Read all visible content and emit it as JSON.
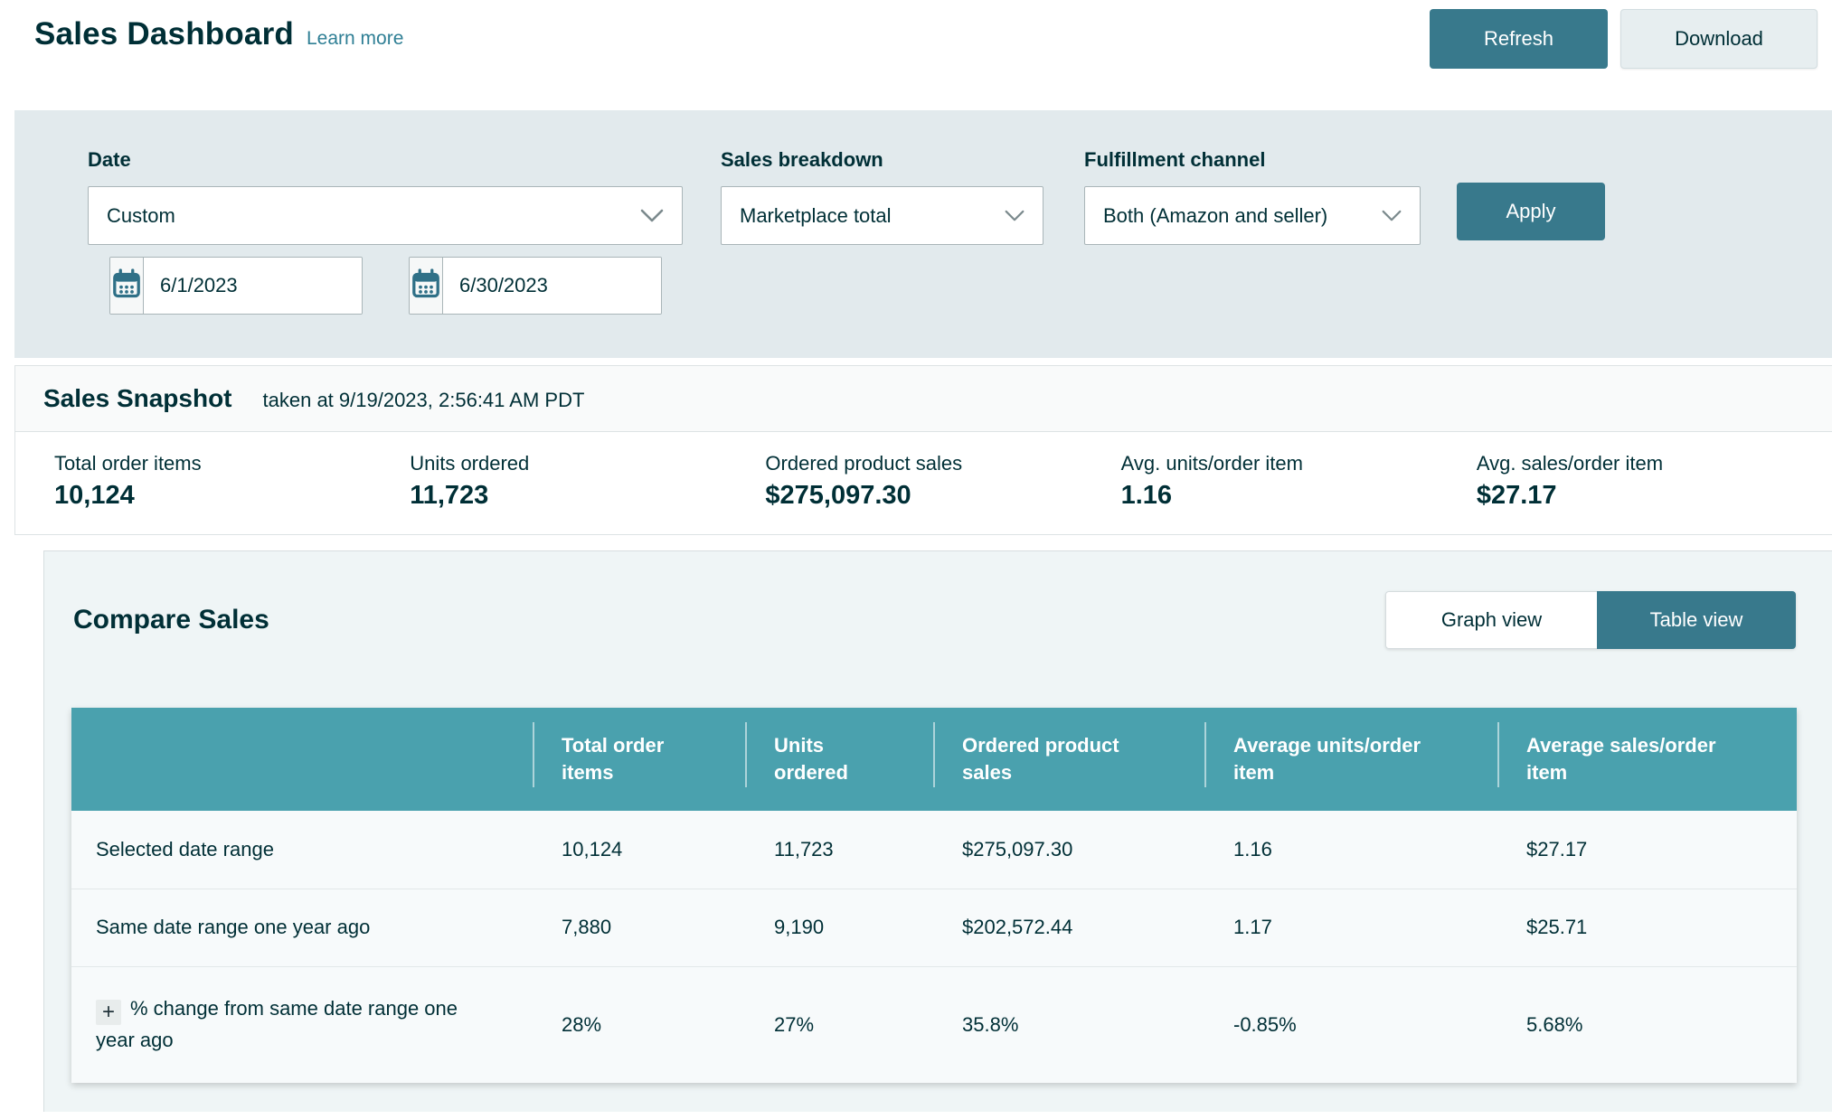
{
  "page": {
    "title": "Sales Dashboard",
    "learn_more": "Learn more"
  },
  "header_actions": {
    "refresh": "Refresh",
    "download": "Download"
  },
  "filters": {
    "date": {
      "label": "Date",
      "value": "Custom",
      "start_date": "6/1/2023",
      "end_date": "6/30/2023"
    },
    "sales_breakdown": {
      "label": "Sales breakdown",
      "value": "Marketplace total"
    },
    "fulfillment_channel": {
      "label": "Fulfillment channel",
      "value": "Both (Amazon and seller)"
    },
    "apply": "Apply"
  },
  "snapshot": {
    "title": "Sales Snapshot",
    "taken_at": "taken at 9/19/2023, 2:56:41 AM PDT",
    "stats": [
      {
        "label": "Total order items",
        "value": "10,124"
      },
      {
        "label": "Units ordered",
        "value": "11,723"
      },
      {
        "label": "Ordered product sales",
        "value": "$275,097.30"
      },
      {
        "label": "Avg. units/order item",
        "value": "1.16"
      },
      {
        "label": "Avg. sales/order item",
        "value": "$27.17"
      }
    ]
  },
  "compare": {
    "title": "Compare Sales",
    "views": {
      "graph": "Graph view",
      "table": "Table view",
      "selected": "Table view"
    },
    "table": {
      "expand_symbol": "+",
      "columns": [
        "",
        "Total order items",
        "Units ordered",
        "Ordered product sales",
        "Average units/order item",
        "Average sales/order item"
      ],
      "rows": [
        {
          "label": "Selected date range",
          "expandable": false,
          "values": [
            "10,124",
            "11,723",
            "$275,097.30",
            "1.16",
            "$27.17"
          ],
          "value_colors": [
            "default",
            "default",
            "default",
            "default",
            "default"
          ]
        },
        {
          "label": "Same date range one year ago",
          "expandable": false,
          "values": [
            "7,880",
            "9,190",
            "$202,572.44",
            "1.17",
            "$25.71"
          ],
          "value_colors": [
            "default",
            "default",
            "default",
            "default",
            "default"
          ]
        },
        {
          "label": "% change from same date range one year ago",
          "expandable": true,
          "values": [
            "28%",
            "27%",
            "35.8%",
            "-0.85%",
            "5.68%"
          ],
          "value_colors": [
            "green",
            "green",
            "green",
            "red",
            "green"
          ]
        }
      ]
    }
  },
  "colors": {
    "accent_teal": "#38798c",
    "table_header_teal": "#4aa1ae",
    "link_teal": "#2f7f95",
    "dark_text": "#002f36",
    "positive_green": "#3a7d2c",
    "negative_red": "#d5392e",
    "filter_bar_bg": "#e2eaed",
    "compare_panel_bg": "#eff5f6"
  }
}
